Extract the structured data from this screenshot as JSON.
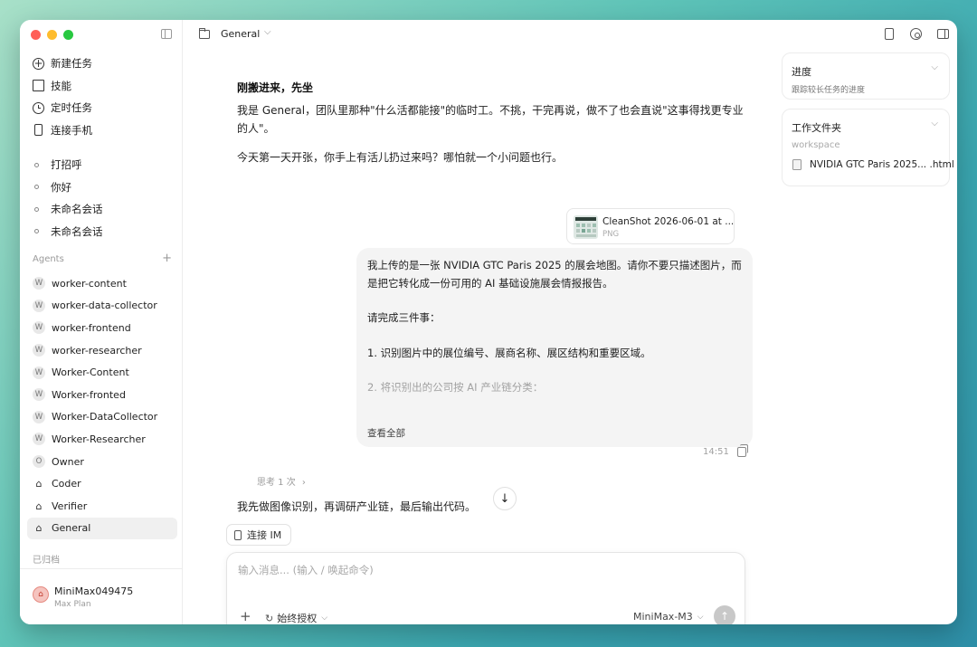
{
  "sidebar": {
    "nav": [
      {
        "label": "新建任务",
        "icon": "plus-circle-icon"
      },
      {
        "label": "技能",
        "icon": "book-icon"
      },
      {
        "label": "定时任务",
        "icon": "clock-icon"
      },
      {
        "label": "连接手机",
        "icon": "phone-icon"
      }
    ],
    "conversations": [
      "打招呼",
      "你好",
      "未命名会话",
      "未命名会话"
    ],
    "agents_header": "Agents",
    "agents": [
      {
        "label": "worker-content",
        "avatar": "W"
      },
      {
        "label": "worker-data-collector",
        "avatar": "W"
      },
      {
        "label": "worker-frontend",
        "avatar": "W"
      },
      {
        "label": "worker-researcher",
        "avatar": "W"
      },
      {
        "label": "Worker-Content",
        "avatar": "W"
      },
      {
        "label": "Worker-fronted",
        "avatar": "W"
      },
      {
        "label": "Worker-DataCollector",
        "avatar": "W"
      },
      {
        "label": "Worker-Researcher",
        "avatar": "W"
      },
      {
        "label": "Owner",
        "avatar": "O"
      },
      {
        "label": "Coder",
        "avatar": "house"
      },
      {
        "label": "Verifier",
        "avatar": "house"
      },
      {
        "label": "General",
        "avatar": "house",
        "active": true
      }
    ],
    "archived_label": "已归档",
    "user": {
      "name": "MiniMax049475",
      "plan": "Max Plan"
    }
  },
  "topbar": {
    "workspace": "General"
  },
  "chat": {
    "assistant_title": "刚搬进来，先坐",
    "assistant_p1": "我是 General，团队里那种\"什么活都能接\"的临时工。不挑，干完再说，做不了也会直说\"这事得找更专业的人\"。",
    "assistant_p2": "今天第一天开张，你手上有活儿扔过来吗？哪怕就一个小问题也行。",
    "attachment": {
      "name": "CleanShot 2026-06-01 at ...",
      "type": "PNG"
    },
    "user_message": {
      "line1": "我上传的是一张 NVIDIA GTC Paris 2025 的展会地图。请你不要只描述图片，而是把它转化成一份可用的 AI 基础设施展会情报报告。",
      "line2": "请完成三件事：",
      "line3": "1. 识别图片中的展位编号、展商名称、展区结构和重要区域。",
      "line4": "2. 将识别出的公司按 AI 产业链分类：",
      "view_all": "查看全部"
    },
    "time": "14:51",
    "thinking": "思考 1 次",
    "thinking_output": "我先做图像识别，再调研产业链，最后输出代码。",
    "connect_im": "连接 IM"
  },
  "composer": {
    "placeholder": "输入消息... (输入 / 唤起命令)",
    "permission": "始终授权",
    "model": "MiniMax-M3"
  },
  "right_panel": {
    "progress_title": "进度",
    "progress_sub": "跟踪较长任务的进度",
    "files_title": "工作文件夹",
    "workspace_label": "workspace",
    "file_name": "NVIDIA GTC Paris 2025... .html"
  },
  "colors": {
    "accent_red": "#ff5f57",
    "accent_yellow": "#febc2e",
    "accent_green": "#28c840",
    "send_disabled": "#c8c8c8"
  }
}
